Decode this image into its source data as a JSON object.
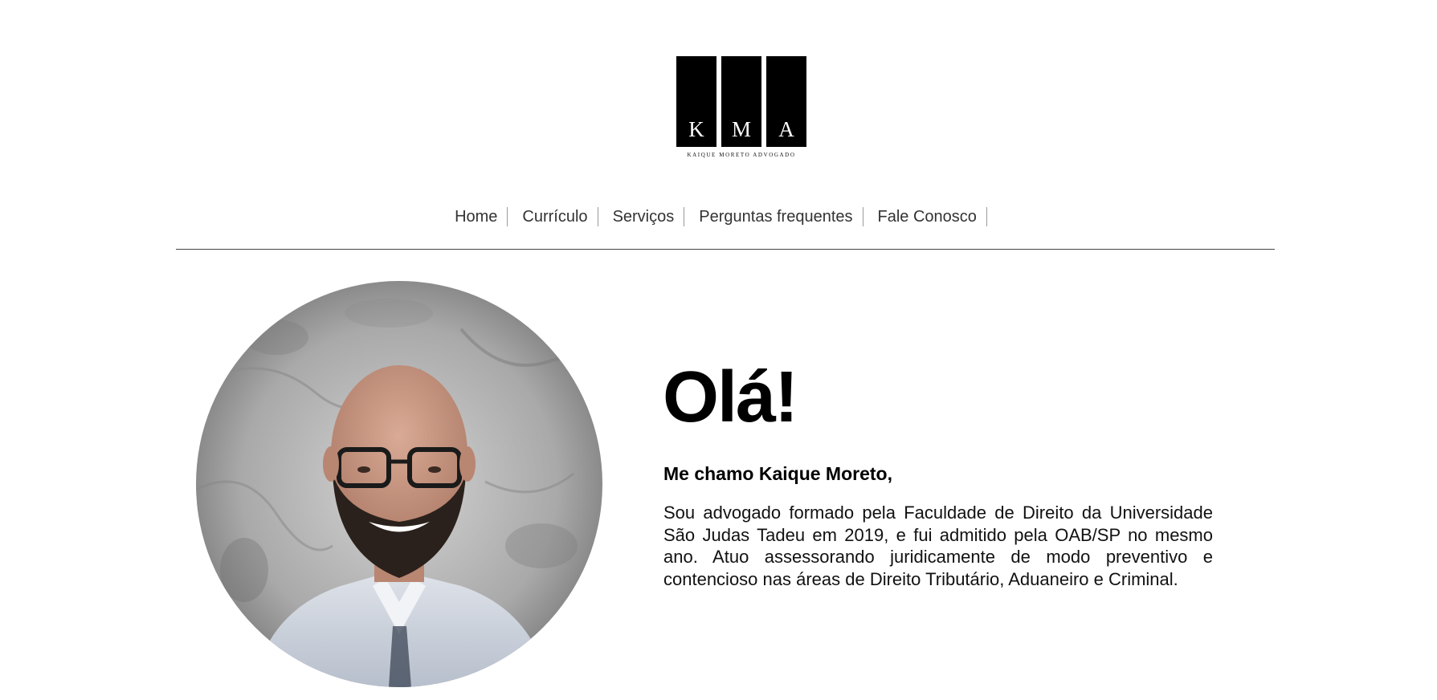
{
  "logo": {
    "letters": [
      "K",
      "M",
      "A"
    ],
    "subtitle": "KAIQUE MORETO ADVOGADO"
  },
  "nav": {
    "items": [
      {
        "label": "Home"
      },
      {
        "label": "Currículo"
      },
      {
        "label": "Serviços"
      },
      {
        "label": "Perguntas frequentes"
      },
      {
        "label": "Fale Conosco"
      }
    ]
  },
  "hero": {
    "greeting": "Olá!",
    "intro": "Me chamo Kaique Moreto,",
    "bio": "Sou advogado formado pela Faculdade de Direito da Universidade São Judas Tadeu em 2019, e fui admitido pela OAB/SP no mesmo ano. Atuo assessorando juridicamente de modo preventivo e contencioso nas áreas de Direito Tributário, Aduaneiro e Criminal."
  },
  "colors": {
    "background": "#ffffff",
    "text": "#111111",
    "logo": "#000000",
    "nav_text": "#333333",
    "divider": "#444444"
  }
}
